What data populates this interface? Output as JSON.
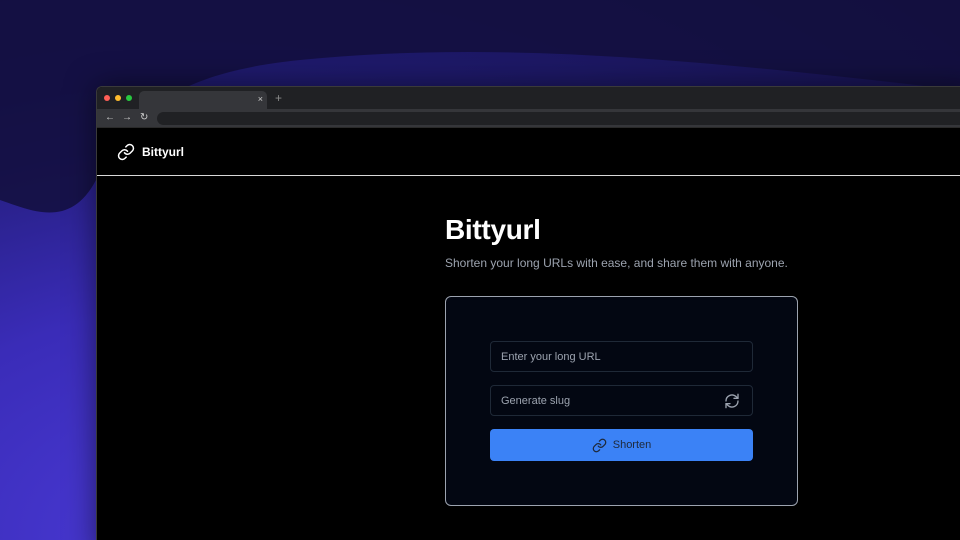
{
  "browser": {
    "tab_close": "×",
    "new_tab": "+",
    "nav": {
      "back": "←",
      "forward": "→",
      "reload": "↻"
    }
  },
  "header": {
    "brand": "Bittyurl"
  },
  "hero": {
    "title": "Bittyurl",
    "subtitle": "Shorten your long URLs with ease, and share them with anyone."
  },
  "form": {
    "url_placeholder": "Enter your long URL",
    "slug_placeholder": "Generate slug",
    "submit_label": "Shorten"
  },
  "icons": {
    "brand": "link-icon",
    "refresh": "refresh-icon",
    "submit": "link-icon"
  },
  "colors": {
    "accent": "#3b82f6",
    "page_bg": "#000000",
    "card_bg": "#030712",
    "card_border": "#9ca3af",
    "backdrop": "#3a2cb8",
    "traffic_red": "#ff5f57",
    "traffic_yellow": "#febc2e",
    "traffic_green": "#28c840"
  }
}
